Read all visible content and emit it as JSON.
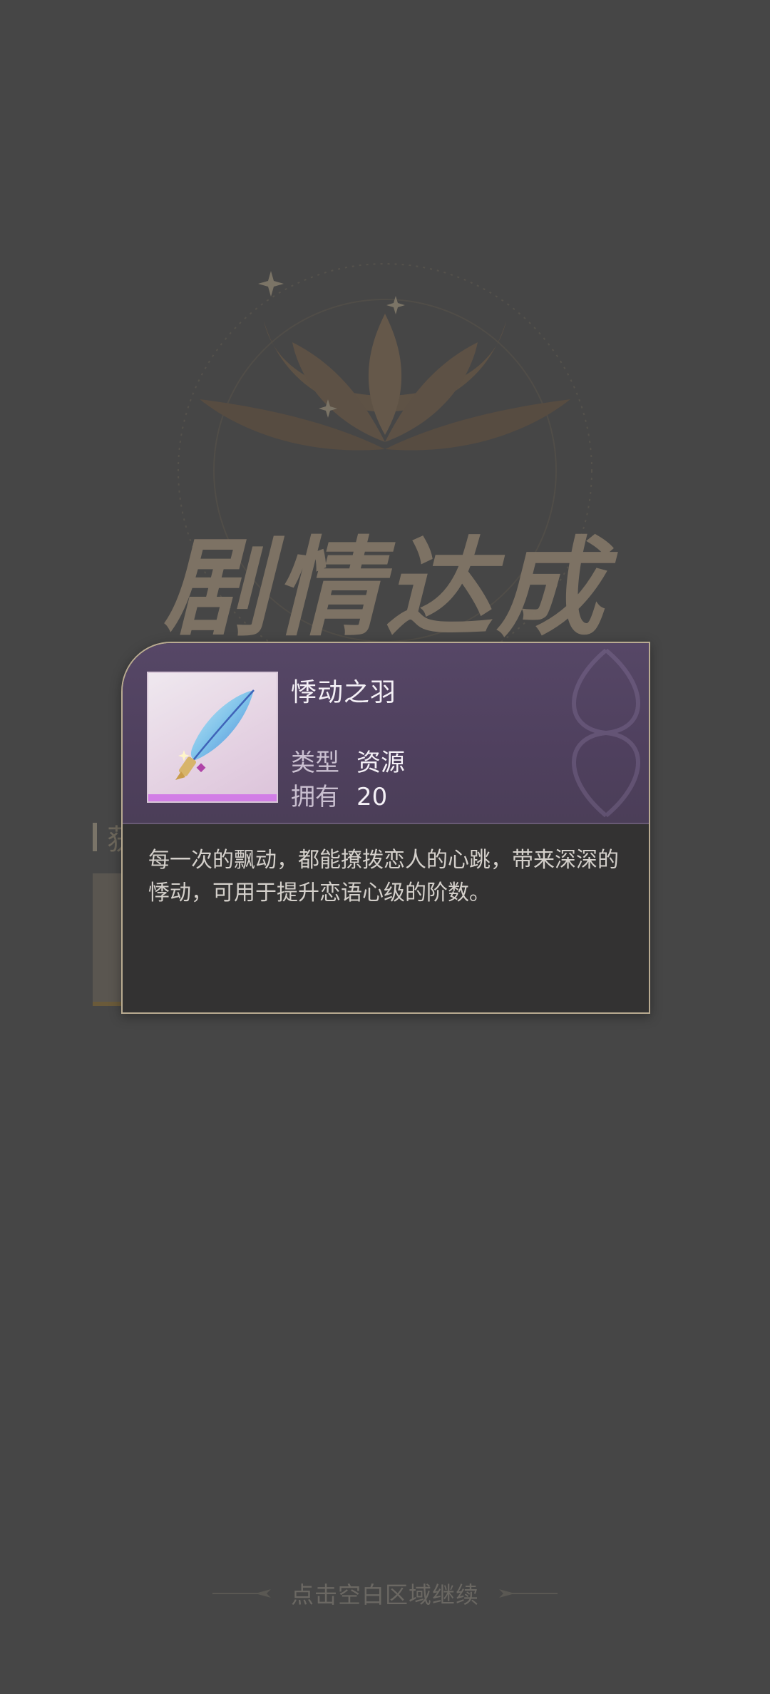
{
  "background": {
    "banner_title": "剧情达成",
    "reward_section_title": "获"
  },
  "popup": {
    "item_name": "悸动之羽",
    "icon": "feather-quill-icon",
    "type_label": "类型",
    "type_value": "资源",
    "owned_label": "拥有",
    "owned_value": "20",
    "description": "每一次的飘动，都能撩拨恋人的心跳，带来深深的悸动，可用于提升恋语心级的阶数。",
    "rarity_color": "#d27ee6"
  },
  "footer": {
    "continue_text": "点击空白区域继续"
  },
  "colors": {
    "overlay_bg": "#464646",
    "popup_header": "#564766",
    "popup_border": "#b9ab91"
  }
}
